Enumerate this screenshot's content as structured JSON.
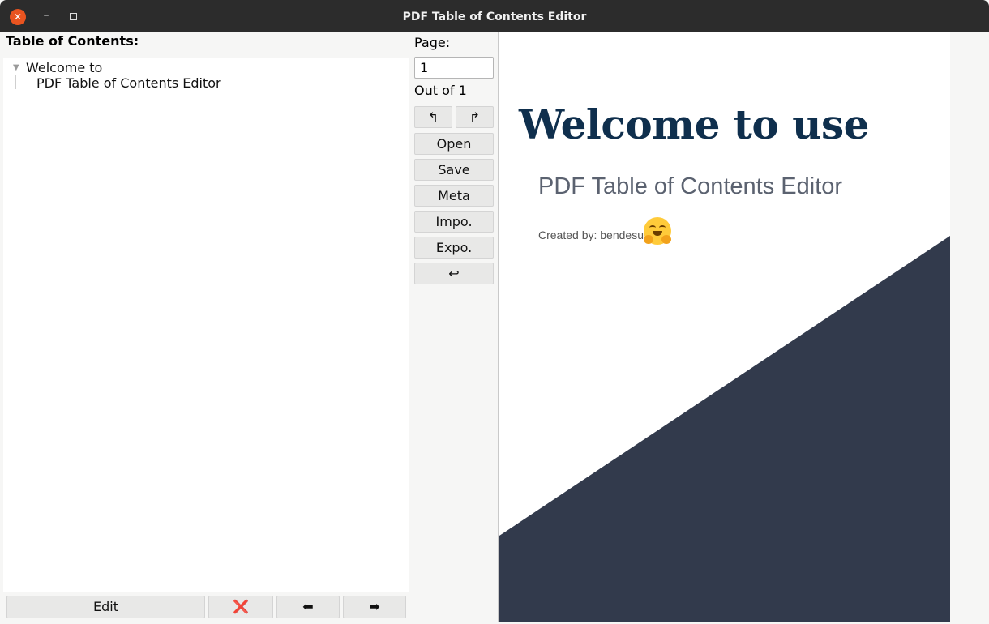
{
  "window": {
    "title": "PDF Table of Contents Editor"
  },
  "toc": {
    "heading": "Table of Contents:",
    "items": [
      {
        "line1": "Welcome to",
        "line2": "PDF Table of Contents Editor"
      }
    ]
  },
  "toc_buttons": {
    "edit": "Edit",
    "delete": "❌",
    "left": "⬅",
    "right": "➡"
  },
  "page": {
    "label": "Page:",
    "value": "1",
    "out_of": "Out of 1"
  },
  "controls": {
    "rotate_left": "↰",
    "rotate_right": "↱",
    "open": "Open",
    "save": "Save",
    "meta": "Meta",
    "import": "Impo.",
    "export": "Expo.",
    "undo": "↩"
  },
  "preview": {
    "headline": "Welcome to use",
    "subtitle": "PDF Table of Contents Editor",
    "credit": "Created by: bendesu",
    "emoji": "hugging-face-emoji",
    "accent_color": "#323a4c",
    "headline_color": "#0f2f4d"
  }
}
